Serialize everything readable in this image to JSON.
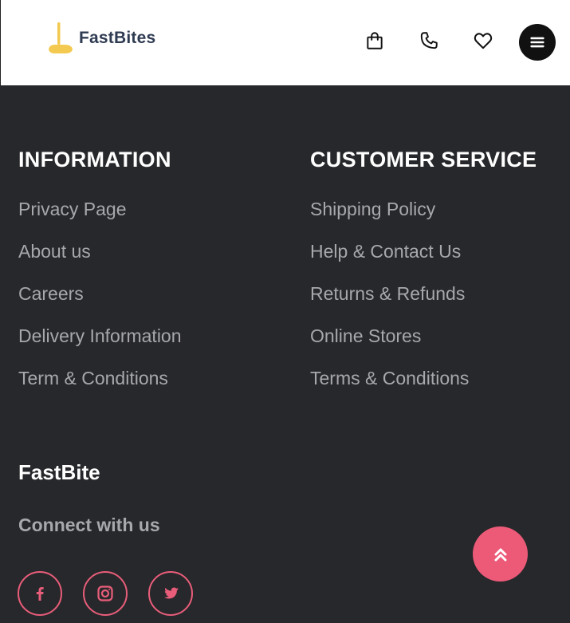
{
  "header": {
    "logo_text": "FastBites",
    "icons": [
      {
        "name": "shopping-bag-icon"
      },
      {
        "name": "phone-icon"
      },
      {
        "name": "heart-icon"
      },
      {
        "name": "menu-icon"
      }
    ]
  },
  "footer": {
    "information": {
      "title": "INFORMATION",
      "links": [
        "Privacy Page",
        "About us",
        "Careers",
        "Delivery Information",
        "Term & Conditions"
      ]
    },
    "customer_service": {
      "title": "CUSTOMER SERVICE",
      "links": [
        "Shipping Policy",
        "Help & Contact Us",
        "Returns & Refunds",
        "Online Stores",
        "Terms & Conditions"
      ]
    },
    "brand_name": "FastBite",
    "connect_label": "Connect with us",
    "social_icons": [
      "facebook-icon",
      "instagram-icon",
      "twitter-icon"
    ]
  },
  "colors": {
    "footer_bg": "#27282b",
    "accent": "#ec5a78",
    "link_text": "#a7a8ab",
    "logo_text": "#2f3b52",
    "logo_mark": "#f3c94f"
  }
}
